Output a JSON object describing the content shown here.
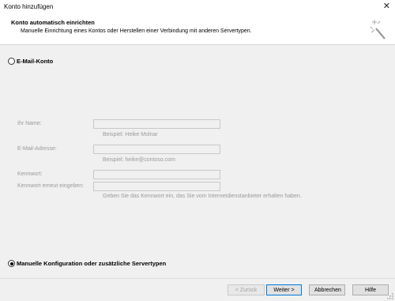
{
  "window": {
    "title": "Konto hinzufügen",
    "close_icon": "close-icon"
  },
  "header": {
    "title": "Konto automatisch einrichten",
    "subtitle": "Manuelle Einrichtung eines Kontos oder Herstellen einer Verbindung mit anderen Servertypen.",
    "icon": "wizard-sparkle-icon"
  },
  "options": {
    "email_account": {
      "label": "E-Mail-Konto",
      "selected": false
    },
    "manual": {
      "label": "Manuelle Konfiguration oder zusätzliche Servertypen",
      "selected": true
    }
  },
  "form": {
    "name_label": "Ihr Name:",
    "name_value": "",
    "name_hint": "Beispiel: Heike Molnar",
    "email_label": "E-Mail-Adresse:",
    "email_value": "",
    "email_hint": "Beispiel: heike@contoso.com",
    "password_label": "Kennwort:",
    "password_value": "",
    "password_repeat_label": "Kennwort erneut eingeben:",
    "password_repeat_value": "",
    "password_hint": "Geben Sie das Kennwort ein, das Sie vom Internetdienstanbieter erhalten haben."
  },
  "buttons": {
    "back": "< Zurück",
    "next": "Weiter >",
    "cancel": "Abbrechen",
    "help": "Hilfe"
  }
}
